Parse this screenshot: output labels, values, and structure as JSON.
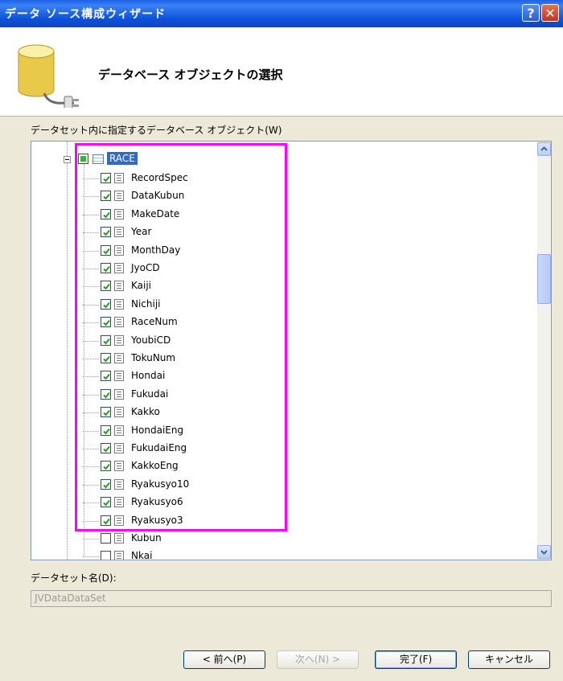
{
  "window": {
    "title": "データ ソース構成ウィザード",
    "help_glyph": "?",
    "close_glyph": "✕"
  },
  "header": {
    "title": "データベース オブジェクトの選択",
    "icon": "database-plug-icon"
  },
  "objects_label": "データセット内に指定するデータベース オブジェクト(W)",
  "tree": {
    "table": {
      "name": "RACE",
      "state": "partial",
      "expanded": true
    },
    "columns": [
      {
        "name": "RecordSpec",
        "checked": true
      },
      {
        "name": "DataKubun",
        "checked": true
      },
      {
        "name": "MakeDate",
        "checked": true
      },
      {
        "name": "Year",
        "checked": true
      },
      {
        "name": "MonthDay",
        "checked": true
      },
      {
        "name": "JyoCD",
        "checked": true
      },
      {
        "name": "Kaiji",
        "checked": true
      },
      {
        "name": "Nichiji",
        "checked": true
      },
      {
        "name": "RaceNum",
        "checked": true
      },
      {
        "name": "YoubiCD",
        "checked": true
      },
      {
        "name": "TokuNum",
        "checked": true
      },
      {
        "name": "Hondai",
        "checked": true
      },
      {
        "name": "Fukudai",
        "checked": true
      },
      {
        "name": "Kakko",
        "checked": true
      },
      {
        "name": "HondaiEng",
        "checked": true
      },
      {
        "name": "FukudaiEng",
        "checked": true
      },
      {
        "name": "KakkoEng",
        "checked": true
      },
      {
        "name": "Ryakusyo10",
        "checked": true
      },
      {
        "name": "Ryakusyo6",
        "checked": true
      },
      {
        "name": "Ryakusyo3",
        "checked": true
      },
      {
        "name": "Kubun",
        "checked": false
      },
      {
        "name": "Nkai",
        "checked": false
      }
    ]
  },
  "dataset_name_label": "データセット名(D):",
  "dataset_name_value": "JVDataDataSet",
  "buttons": {
    "prev": "< 前へ(P)",
    "next": "次へ(N) >",
    "finish": "完了(F)",
    "cancel": "キャンセル"
  },
  "colors": {
    "highlight": "#ff00ff",
    "title_bar": "#0a52d9",
    "selection": "#316ac5"
  }
}
